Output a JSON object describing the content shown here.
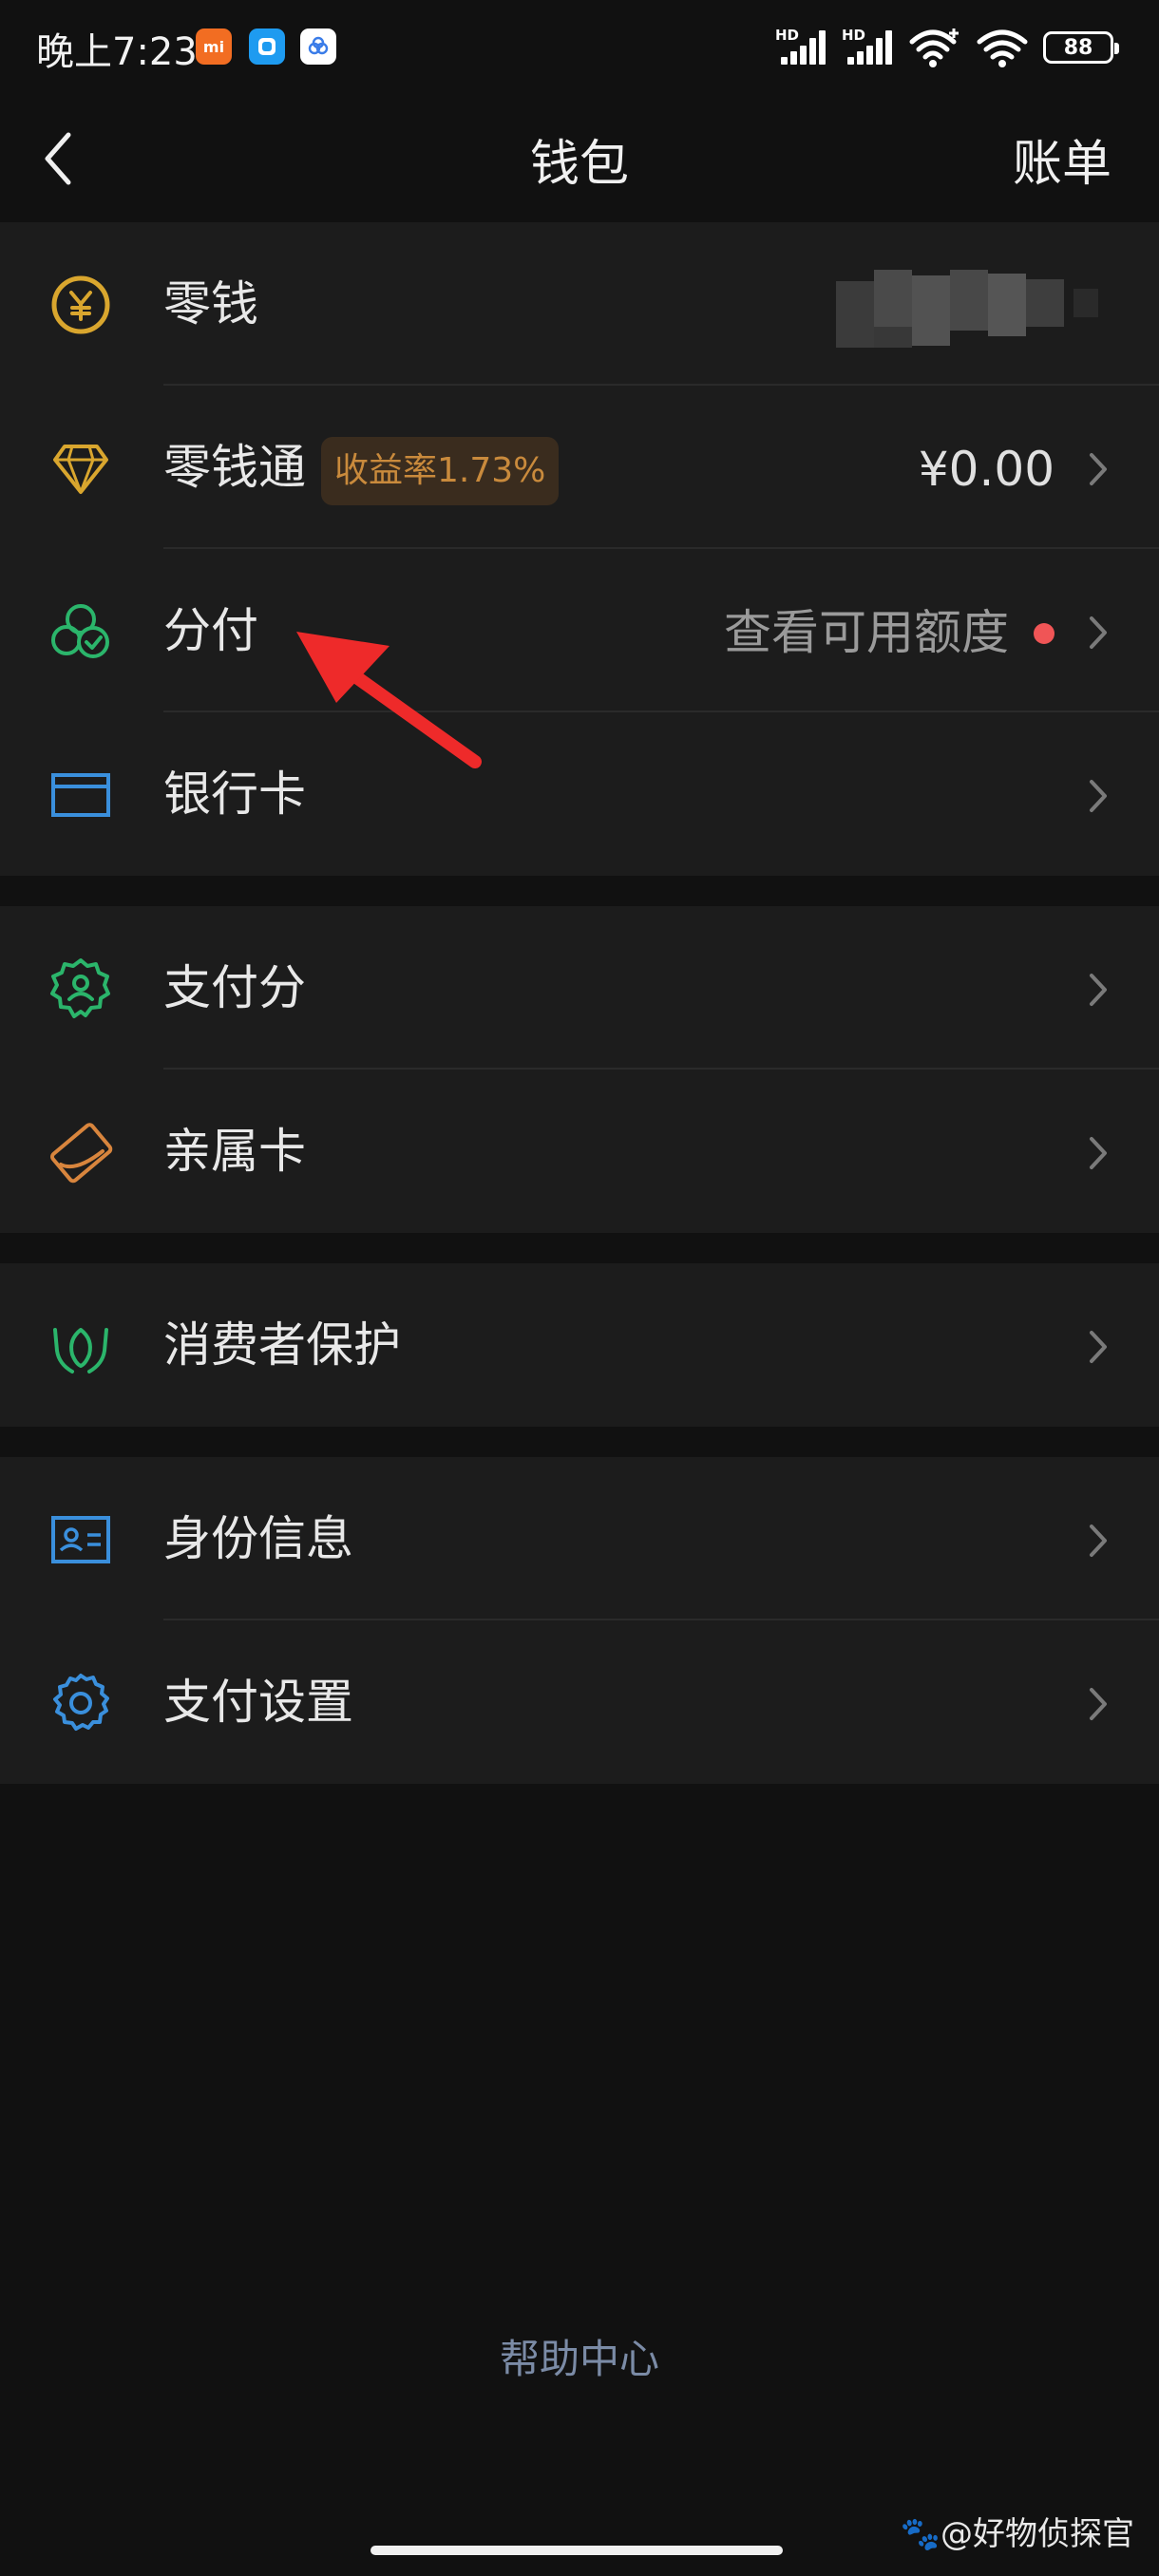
{
  "status_bar": {
    "time": "晚上7:23",
    "hd1": "HD",
    "hd2": "HD",
    "battery": "88"
  },
  "nav": {
    "title": "钱包",
    "bill": "账单"
  },
  "items": [
    {
      "label": "零钱",
      "value": "",
      "icon": "yuan-coin-icon"
    },
    {
      "label": "零钱通",
      "badge": "收益率1.73%",
      "value": "¥0.00",
      "icon": "diamond-icon"
    },
    {
      "label": "分付",
      "value": "查看可用额度",
      "icon": "clover-check-icon"
    },
    {
      "label": "银行卡",
      "value": "",
      "icon": "bank-card-icon"
    },
    {
      "label": "支付分",
      "value": "",
      "icon": "badge-person-icon"
    },
    {
      "label": "亲属卡",
      "value": "",
      "icon": "family-card-icon"
    },
    {
      "label": "消费者保护",
      "value": "",
      "icon": "protect-hands-icon"
    },
    {
      "label": "身份信息",
      "value": "",
      "icon": "id-card-icon"
    },
    {
      "label": "支付设置",
      "value": "",
      "icon": "gear-icon"
    }
  ],
  "footer": {
    "help": "帮助中心",
    "watermark": "@好物侦探官"
  },
  "colors": {
    "background": "#111111",
    "group": "#1c1c1c",
    "gold": "#d9a62e",
    "green": "#2bb56b",
    "blue": "#3a8fdc",
    "orange": "#d8853d",
    "red_dot": "#f05556",
    "badge_text": "#c98a3c"
  }
}
